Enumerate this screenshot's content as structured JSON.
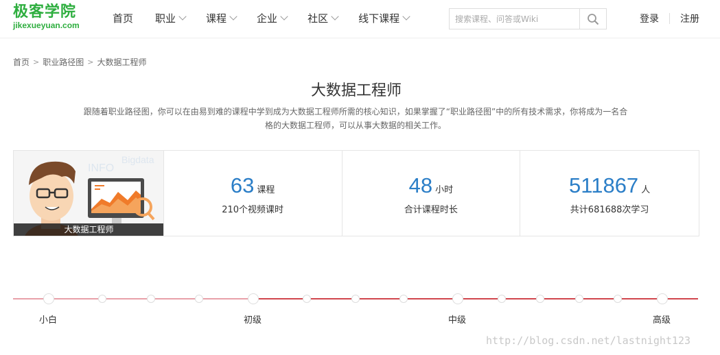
{
  "header": {
    "logo_title": "极客学院",
    "logo_sub": "jikexueyuan.com",
    "nav": [
      {
        "label": "首页",
        "has_dropdown": false
      },
      {
        "label": "职业",
        "has_dropdown": true
      },
      {
        "label": "课程",
        "has_dropdown": true
      },
      {
        "label": "企业",
        "has_dropdown": true
      },
      {
        "label": "社区",
        "has_dropdown": true
      },
      {
        "label": "线下课程",
        "has_dropdown": true
      }
    ],
    "search_placeholder": "搜索课程、问答或Wiki",
    "login": "登录",
    "register": "注册"
  },
  "breadcrumb": [
    "首页",
    "职业路径图",
    "大数据工程师"
  ],
  "page": {
    "title": "大数据工程师",
    "desc_line1": "跟随着职业路径图，你可以在由易到难的课程中学到成为大数据工程师所需的核心知识，如果掌握了“职业路径图”中的所有技术需求，你将成为一名合",
    "desc_line2": "格的大数据工程师，可以从事大数据的相关工作。"
  },
  "stats": {
    "image_caption": "大数据工程师",
    "image_text_info": "INFO",
    "image_text_bigdata": "Bigdata",
    "courses": {
      "value": "63",
      "unit": "课程",
      "sub": "210个视频课时"
    },
    "hours": {
      "value": "48",
      "unit": "小时",
      "sub": "合计课程时长"
    },
    "people": {
      "value": "511867",
      "unit": "人",
      "sub": "共计681688次学习"
    }
  },
  "timeline": {
    "levels": [
      "小白",
      "初级",
      "中级",
      "高级"
    ],
    "colors": {
      "light": "#e8a0a8",
      "dark": "#d0454c"
    }
  },
  "watermark": "http://blog.csdn.net/lastnight123"
}
